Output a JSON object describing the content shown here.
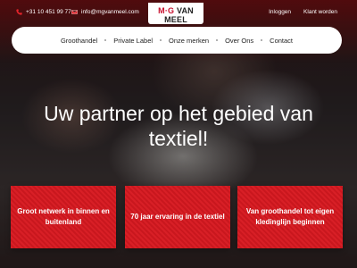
{
  "topbar": {
    "phone": "+31 10 451 99 77",
    "email": "info@mgvanmeel.com",
    "links": [
      "Inloggen",
      "Klant worden"
    ]
  },
  "logo": {
    "brand_mg": "M·G",
    "brand_name": "VAN MEEL",
    "est": "EST 1952"
  },
  "nav": {
    "items": [
      "Groothandel",
      "Private Label",
      "Onze merken",
      "Over Ons",
      "Contact"
    ]
  },
  "hero": {
    "title_line1": "Uw partner op het gebied van",
    "title_line2": "textiel!"
  },
  "cards": [
    "Groot netwerk in binnen en buitenland",
    "70 jaar ervaring in de textiel",
    "Van groothandel tot eigen kledinglijn beginnen"
  ],
  "colors": {
    "accent": "#d81f26",
    "nav_bg": "#ffffff"
  }
}
